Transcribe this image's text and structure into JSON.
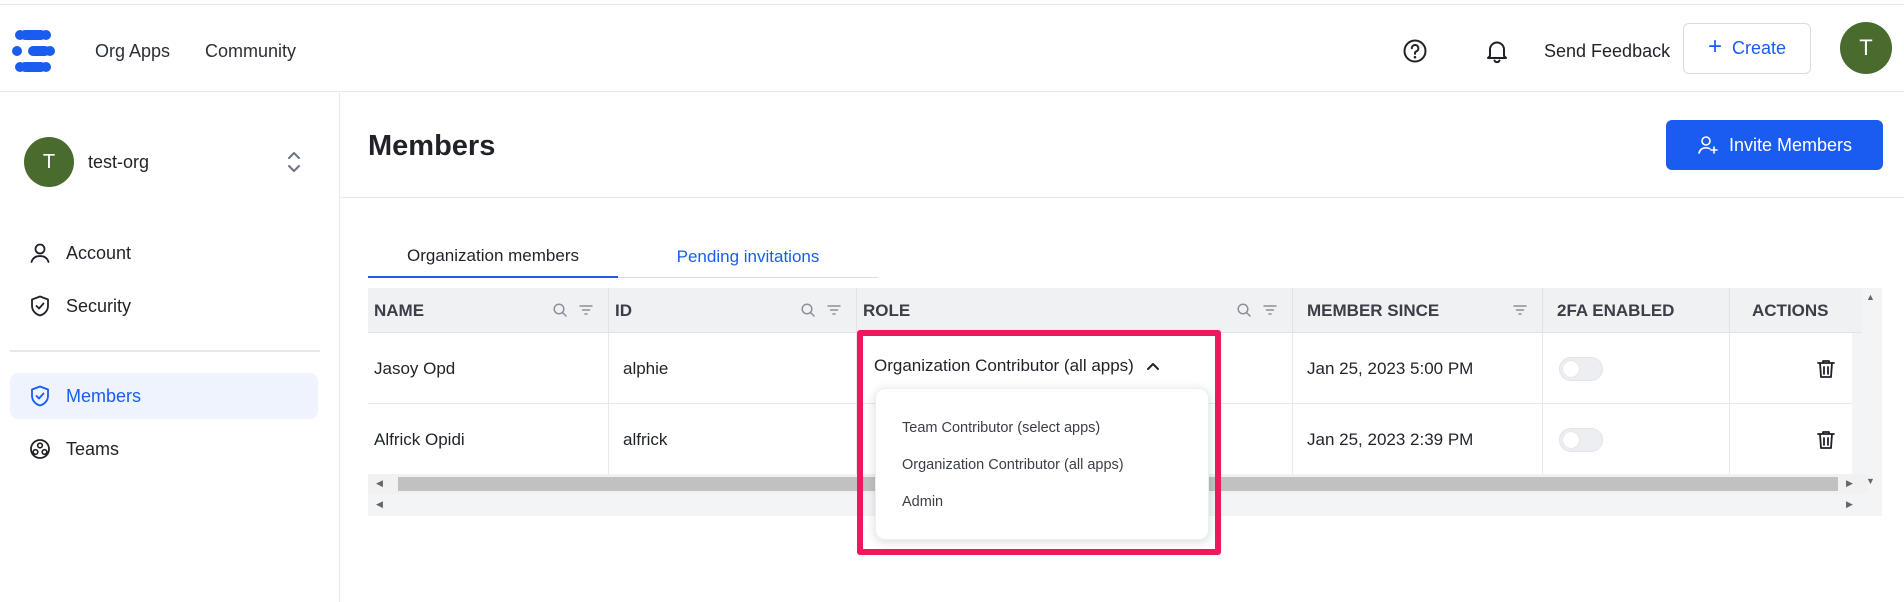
{
  "header": {
    "nav": [
      "Org Apps",
      "Community"
    ],
    "feedback_label": "Send Feedback",
    "create_label": "Create",
    "avatar_initial": "T"
  },
  "sidebar": {
    "org_initial": "T",
    "org_name": "test-org",
    "items": [
      {
        "label": "Account",
        "icon": "user-icon"
      },
      {
        "label": "Security",
        "icon": "shield-icon"
      },
      {
        "label": "Members",
        "icon": "shield-check-icon",
        "active": true
      },
      {
        "label": "Teams",
        "icon": "teams-icon"
      }
    ]
  },
  "main": {
    "title": "Members",
    "invite_label": "Invite Members",
    "tabs": [
      {
        "label": "Organization members",
        "active": true
      },
      {
        "label": "Pending invitations",
        "active": false
      }
    ]
  },
  "table": {
    "columns": [
      "NAME",
      "ID",
      "ROLE",
      "MEMBER SINCE",
      "2FA ENABLED",
      "ACTIONS"
    ],
    "rows": [
      {
        "name": "Jasoy Opd",
        "id": "alphie",
        "role": "Organization Contributor (all apps)",
        "member_since": "Jan 25, 2023 5:00 PM",
        "twofa": false
      },
      {
        "name": "Alfrick Opidi",
        "id": "alfrick",
        "role": "",
        "member_since": "Jan 25, 2023 2:39 PM",
        "twofa": false
      }
    ]
  },
  "role_dropdown": {
    "selected": "Organization Contributor (all apps)",
    "options": [
      "Team Contributor (select apps)",
      "Organization Contributor (all apps)",
      "Admin"
    ]
  },
  "colors": {
    "accent": "#1a5cf0",
    "avatar": "#4a6b2e",
    "highlight": "#f0185c"
  }
}
